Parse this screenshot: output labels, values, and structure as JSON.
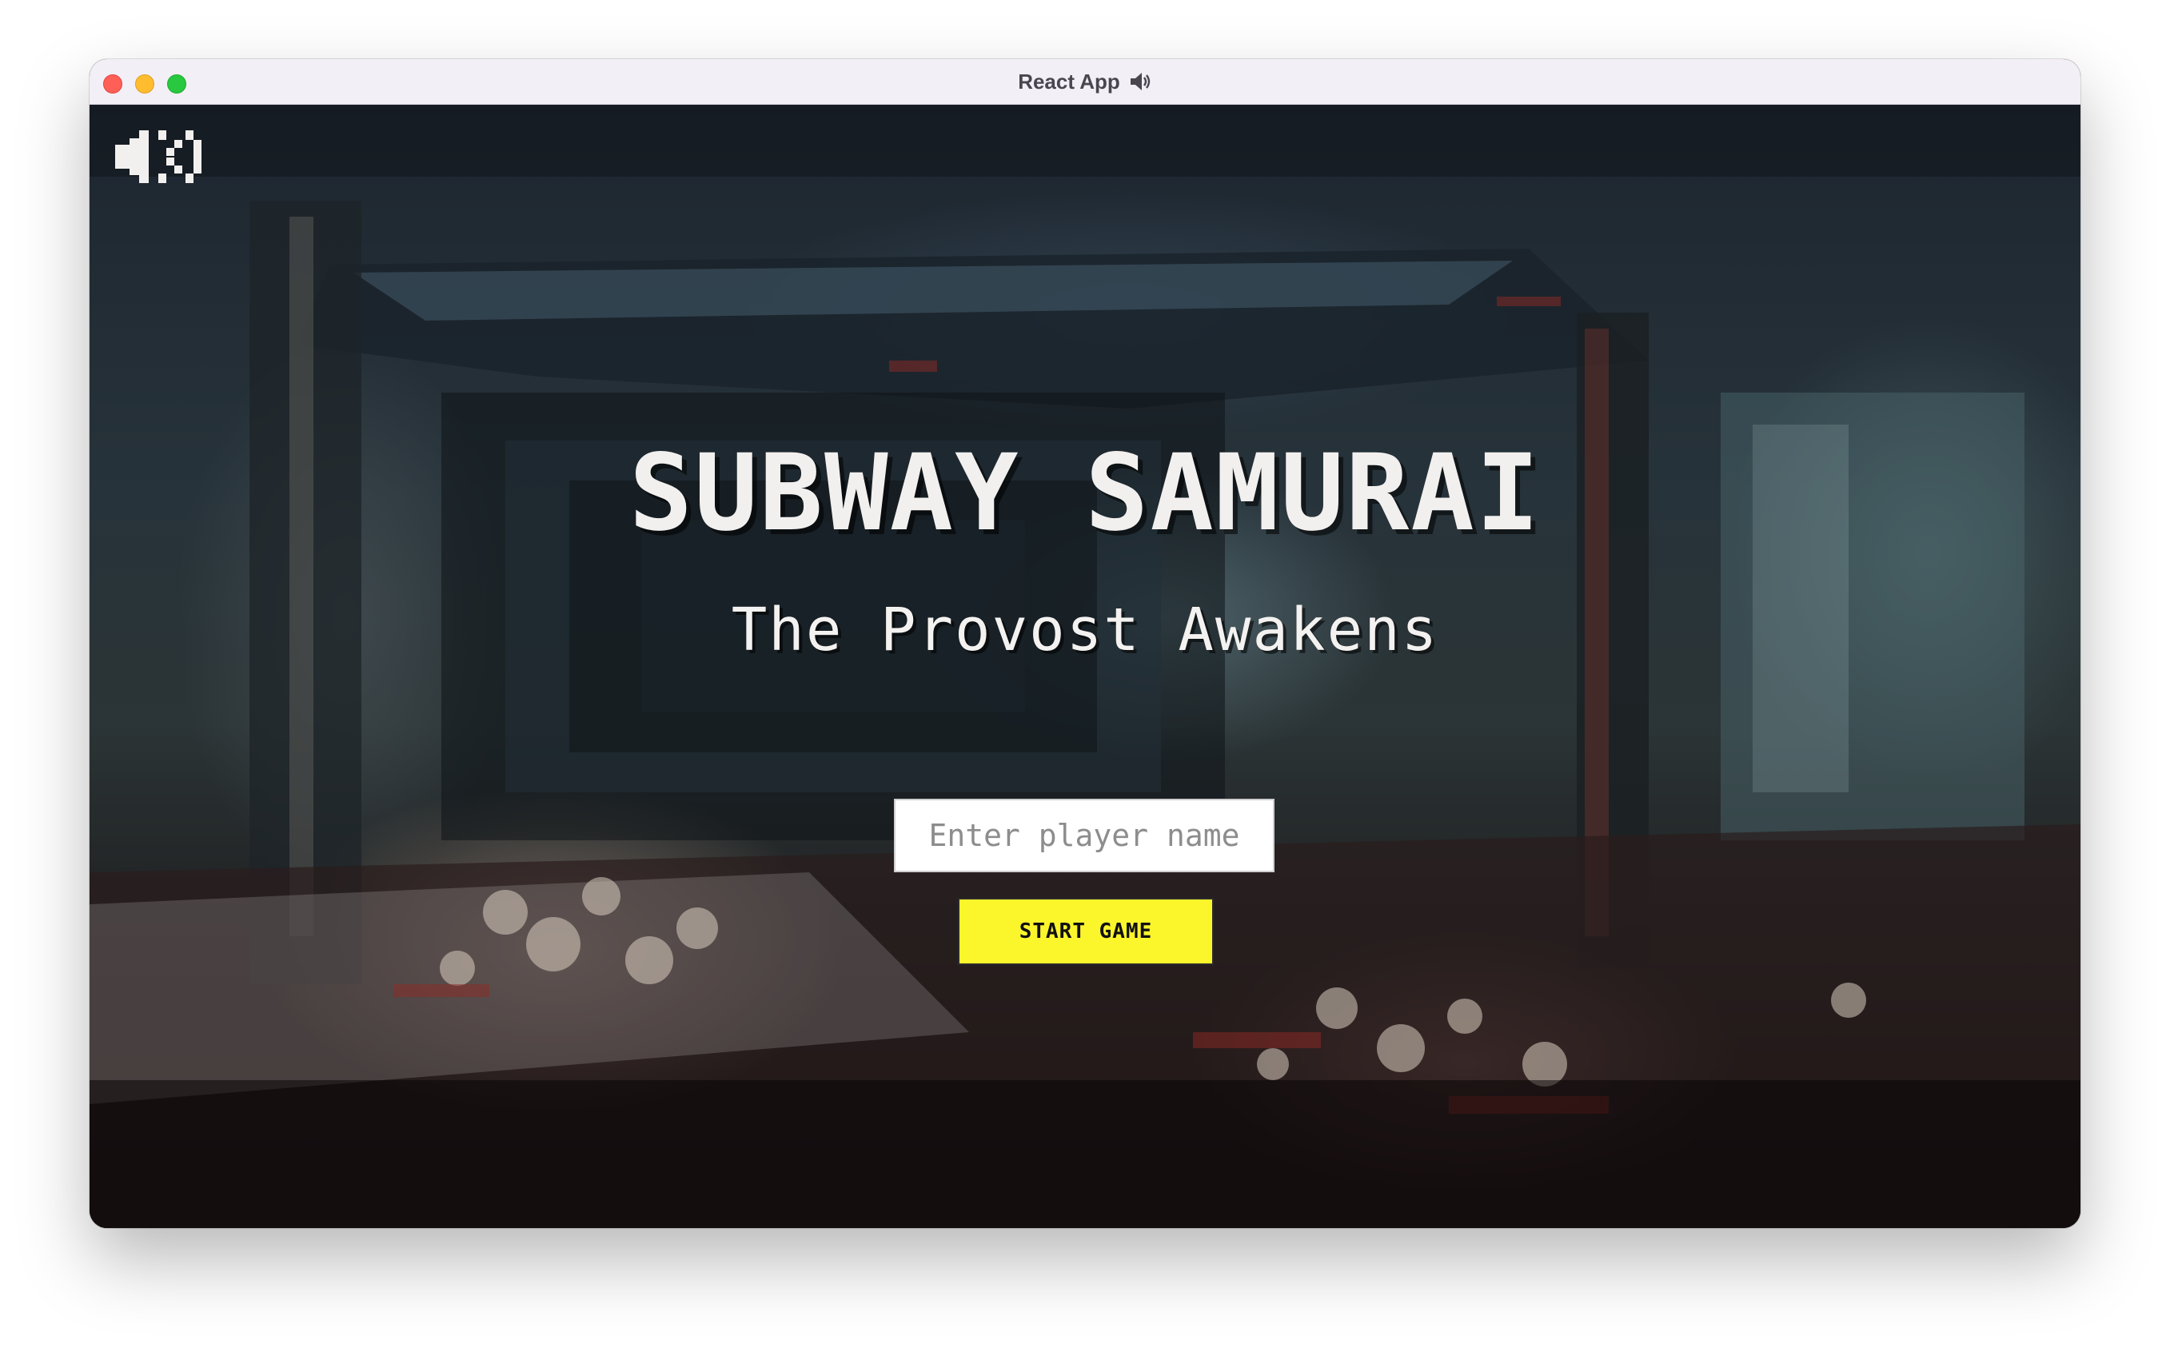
{
  "window": {
    "title": "React App",
    "title_icon": "speaker-icon",
    "traffic_lights": {
      "close_color": "#fe5f57",
      "minimize_color": "#febc2e",
      "maximize_color": "#28c840"
    }
  },
  "game": {
    "title": "SUBWAY SAMURAI",
    "subtitle": "The Provost Awakens",
    "sound_toggle_icon": "sound-muted-icon",
    "player_name": {
      "value": "",
      "placeholder": "Enter player name"
    },
    "start_button_label": "START GAME",
    "colors": {
      "start_button": "#fbf52c",
      "title_text": "#f2f0ee"
    }
  }
}
